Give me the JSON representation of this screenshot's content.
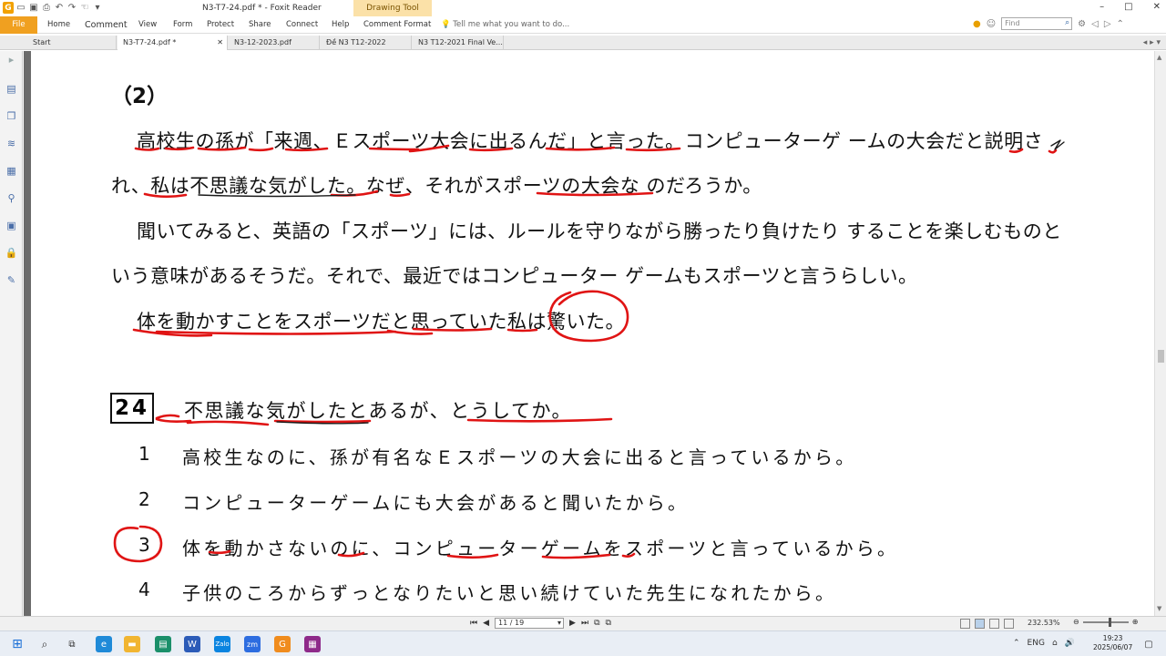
{
  "window": {
    "title": "N3-T7-24.pdf * - Foxit Reader",
    "context_tab": "Drawing Tool",
    "controls": [
      "–",
      "□",
      "✕"
    ]
  },
  "ribbon": {
    "file": "File",
    "tabs": [
      "Home",
      "Comment",
      "View",
      "Form",
      "Protect",
      "Share",
      "Connect",
      "Help",
      "Comment Format"
    ],
    "tell_me": "Tell me what you want to do...",
    "find_placeholder": "Find"
  },
  "doc_tabs": [
    {
      "label": "Start",
      "active": false
    },
    {
      "label": "N3-T7-24.pdf *",
      "active": true,
      "close": "✕"
    },
    {
      "label": "N3-12-2023.pdf",
      "active": false
    },
    {
      "label": "Đề N3 T12-2022 Final...",
      "active": false
    },
    {
      "label": "N3 T12-2021 Final Ve...",
      "active": false
    }
  ],
  "document": {
    "section": "（2）",
    "paragraph_lines": [
      "高校生の孫が「来週、Ｅスポーツ大会に出るんだ」と言った。コンピューターゲ ームの大会だと説明さ",
      "れ、私は不思議な気がした。なぜ、それがスポーツの大会な のだろうか。",
      "聞いてみると、英語の「スポーツ」には、ルールを守りながら勝ったり負けたり することを楽しむものと",
      "いう意味があるそうだ。それで、最近ではコンピューター ゲームもスポーツと言うらしい。",
      "体を動かすことをスポーツだと思っていた私は驚いた。"
    ],
    "question_number": "24",
    "question_text": "不思議な気がしたとあるが、とうしてか。",
    "options": [
      {
        "num": "1",
        "text": "高校生なのに、孫が有名なＥスポーツの大会に出ると言っているから。"
      },
      {
        "num": "2",
        "text": "コンピューターゲームにも大会があると聞いたから。"
      },
      {
        "num": "3",
        "text": "体を動かさないのに、コンピューターゲームをスポーツと言っているから。"
      },
      {
        "num": "4",
        "text": "子供のころからずっとなりたいと思い続けていた先生になれたから。"
      }
    ],
    "ink_color": "#e01414"
  },
  "status": {
    "page": "11 / 19",
    "zoom": "232.53%"
  },
  "taskbar": {
    "lang": "ENG",
    "time": "19:23",
    "date": "2025/06/07"
  }
}
